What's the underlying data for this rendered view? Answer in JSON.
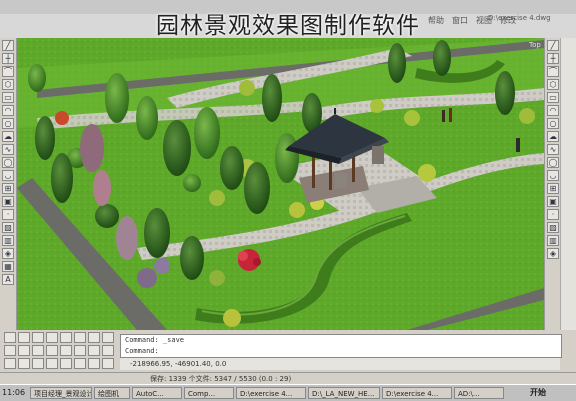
{
  "caption": "园林景观效果图制作软件",
  "window": {
    "menu": [
      "帮助",
      "窗口",
      "视图",
      "修改"
    ],
    "file_path": "D:\\exercise 4.dwg"
  },
  "drawing": {
    "ucs_label": "Top"
  },
  "command": {
    "history": "Command: _save",
    "prompt": "Command:"
  },
  "coords": "-218966.95, -46901.40, 0.0",
  "status": "保存: 1339 个文件: 5347 / 5530 (0.0 : 29)",
  "taskbar": {
    "clock": "11:06",
    "tasks": [
      "项目经理_景观设计",
      "绘图机",
      "AutoC...",
      "Comp...",
      "D:\\exercise 4...",
      "D:\\_LA_NEW_HE...",
      "D:\\exercise 4...",
      "AD:\\..."
    ],
    "start": "开始"
  },
  "icons": {
    "left": [
      "line-icon",
      "xline-icon",
      "polyline-icon",
      "polygon-icon",
      "rectangle-icon",
      "arc-icon",
      "circle-icon",
      "revcloud-icon",
      "spline-icon",
      "ellipse-icon",
      "ellipse-arc-icon",
      "insert-icon",
      "block-icon",
      "point-icon",
      "hatch-icon",
      "gradient-icon",
      "region-icon",
      "table-icon",
      "mtext-icon"
    ],
    "right": [
      "erase-icon",
      "copy-icon",
      "mirror-icon",
      "offset-icon",
      "array-icon",
      "move-icon",
      "rotate-icon",
      "scale-icon",
      "stretch-icon",
      "trim-icon",
      "extend-icon",
      "break-icon",
      "join-icon",
      "chamfer-icon",
      "fillet-icon",
      "explode-icon",
      "text-icon"
    ]
  },
  "colors": {
    "lawn": "#5ea82a",
    "path": "#c9c6c0",
    "road": "#6b6b68",
    "hedge": "#3f7d1c",
    "pavilion_roof": "#2d3640"
  }
}
